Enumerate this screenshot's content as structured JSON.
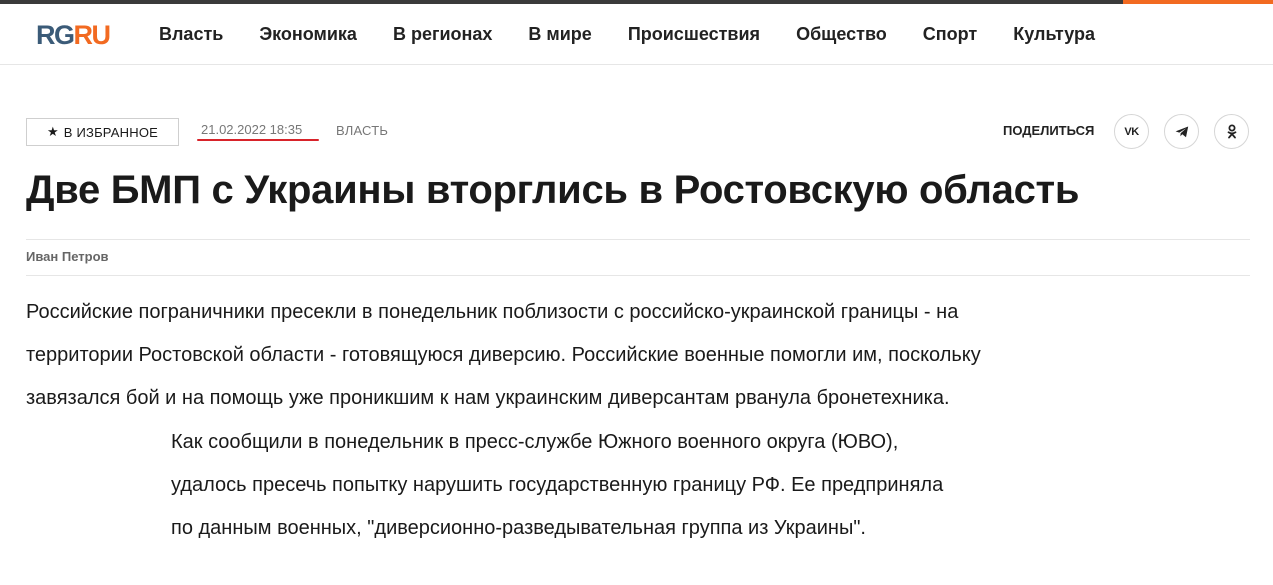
{
  "header": {
    "logo_rg": "RG",
    "logo_ru": "RU",
    "nav": [
      "Власть",
      "Экономика",
      "В регионах",
      "В мире",
      "Происшествия",
      "Общество",
      "Спорт",
      "Культура"
    ]
  },
  "meta": {
    "favorite_label": "В ИЗБРАННОЕ",
    "date": "21.02.2022 18:35",
    "rubric": "ВЛАСТЬ",
    "share_label": "ПОДЕЛИТЬСЯ",
    "share_vk": "VK"
  },
  "article": {
    "title": "Две БМП с Украины вторглись в Ростовскую область",
    "author": "Иван Петров",
    "lead_lines": [
      "Российские пограничники пресекли в понедельник поблизости с российско-украинской границы - на",
      "территории Ростовской области - готовящуюся диверсию. Российские военные помогли им, поскольку",
      "завязался бой и на помощь уже проникшим к нам украинским диверсантам рванула бронетехника."
    ],
    "quote_lines": [
      "Как сообщили в понедельник в пресс-службе Южного военного округа (ЮВО),",
      "удалось пресечь попытку нарушить государственную границу РФ. Ее предприняла",
      "по данным военных, \"диверсионно-разведывательная группа из Украины\"."
    ]
  },
  "colors": {
    "accent": "#f26a21",
    "logo_blue": "#3b5b78",
    "underline_red": "#d8232a"
  },
  "icons": [
    "star-icon",
    "vk-icon",
    "telegram-icon",
    "odnoklassniki-icon"
  ]
}
